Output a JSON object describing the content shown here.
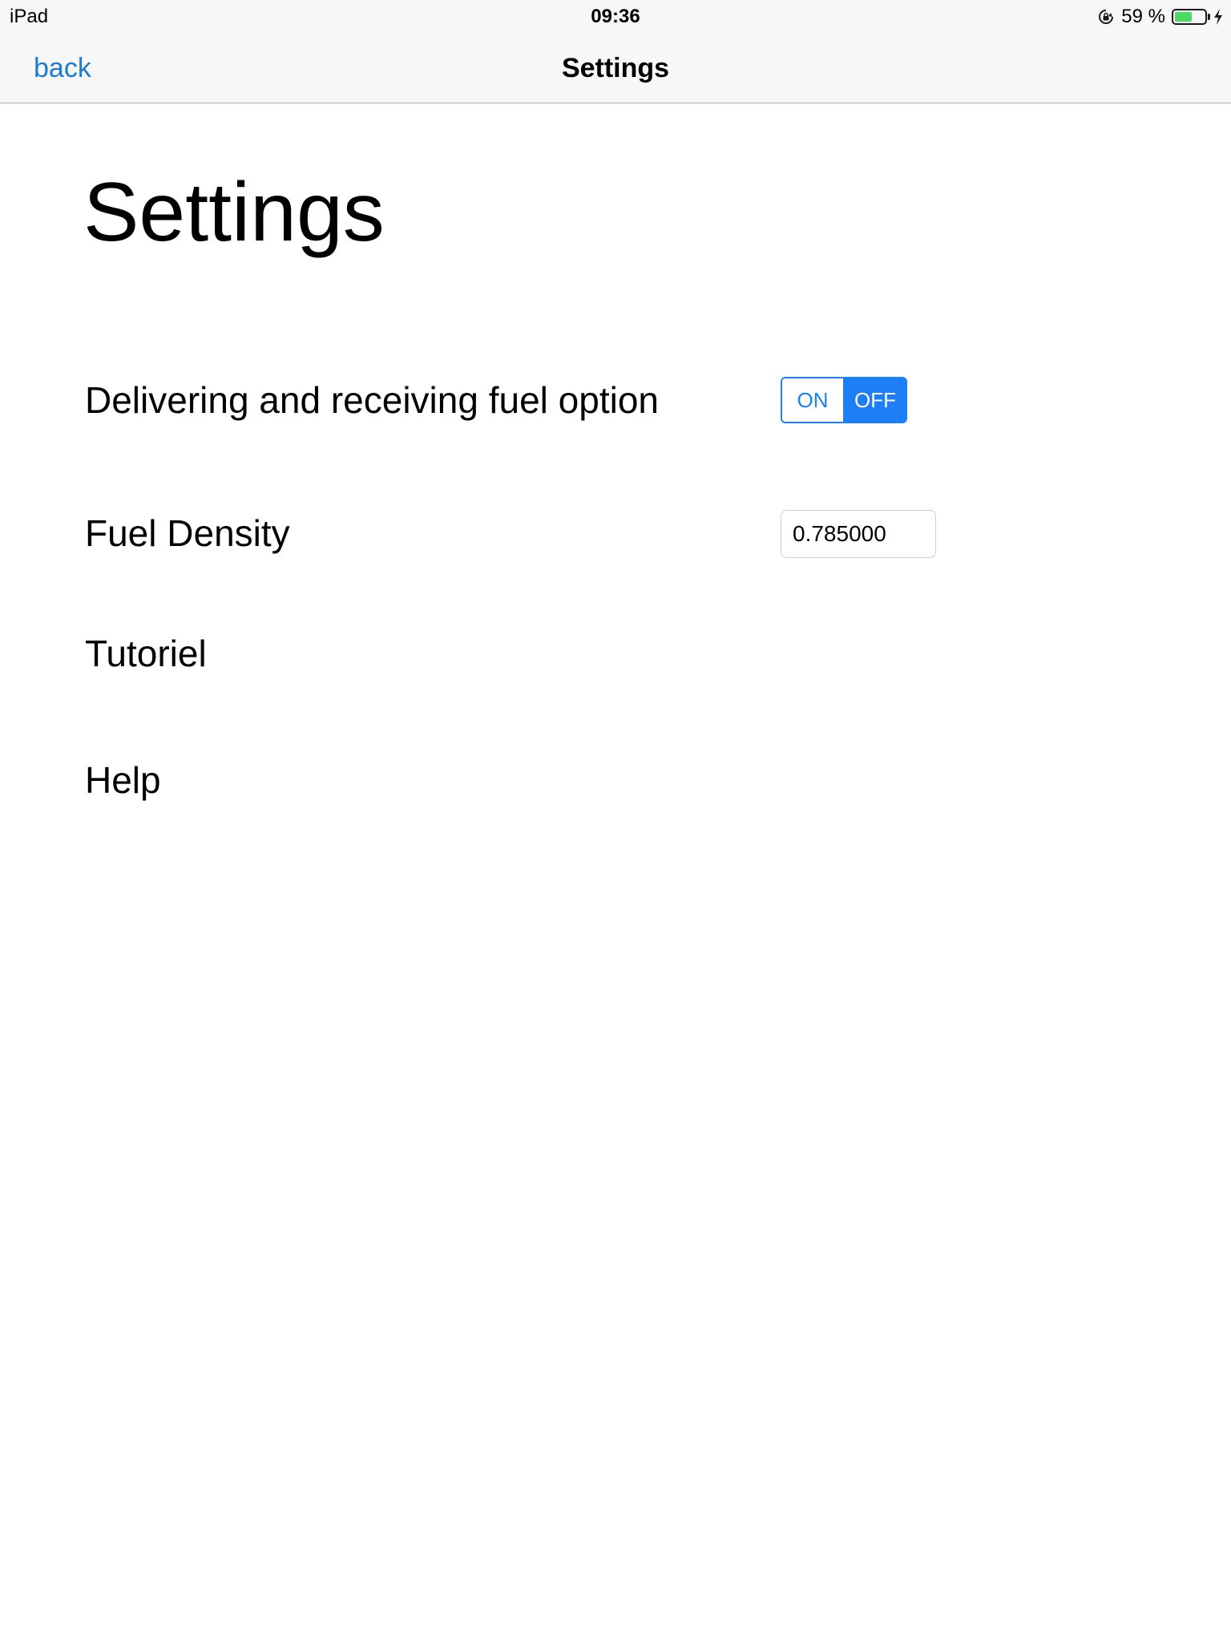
{
  "status_bar": {
    "device": "iPad",
    "time": "09:36",
    "battery_text": "59 %",
    "battery_level": 0.59,
    "icons": [
      "orientation-lock-icon",
      "battery-icon",
      "charging-icon"
    ]
  },
  "nav": {
    "back_label": "back",
    "title": "Settings"
  },
  "page": {
    "heading": "Settings"
  },
  "settings": {
    "fuel_option": {
      "label": "Delivering and receiving fuel option",
      "on_label": "ON",
      "off_label": "OFF",
      "selected": "OFF"
    },
    "density": {
      "label": "Fuel Density",
      "value": "0.785000"
    },
    "tutorial": {
      "label": "Tutoriel"
    },
    "help": {
      "label": "Help"
    }
  },
  "colors": {
    "accent": "#1e7ef5",
    "nav_link": "#1c7ccf",
    "battery": "#4cd964",
    "bar_background": "#f7f7f7"
  }
}
